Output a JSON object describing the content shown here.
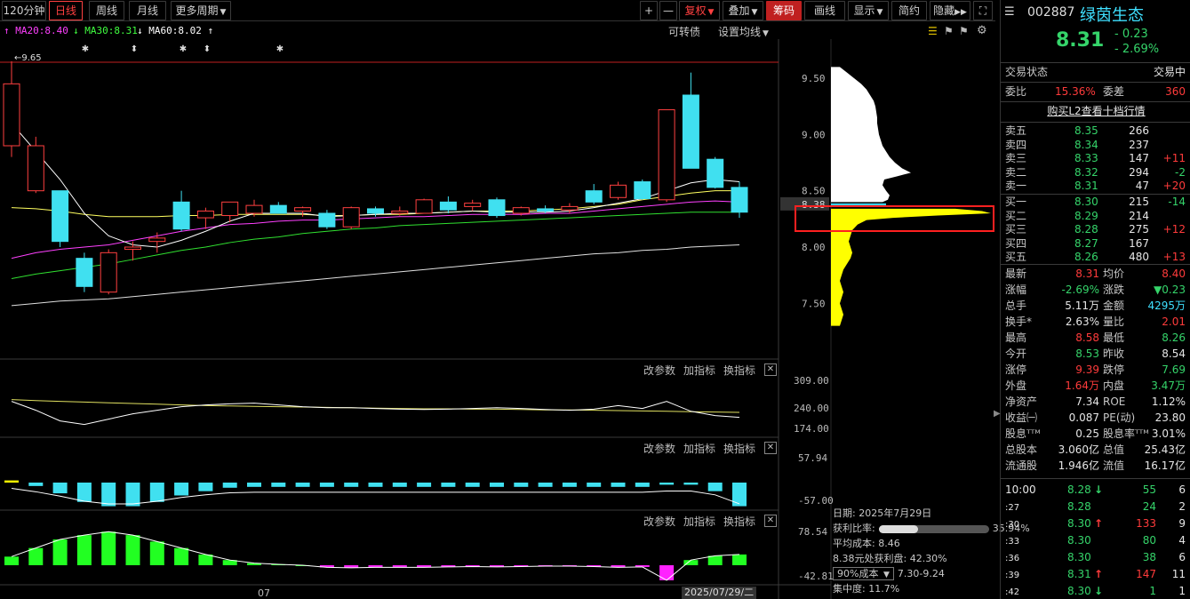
{
  "toolbar": {
    "period_120": "120分钟",
    "daily": "日线",
    "weekly": "周线",
    "monthly": "月线",
    "more_periods": "更多周期",
    "plus": "+",
    "minus": "—",
    "restore_right": "复权",
    "overlay": "叠加",
    "chips": "筹码",
    "draw": "画线",
    "display": "显示",
    "simple": "简约",
    "hide": "隐藏"
  },
  "ma_legend": {
    "ma20": "MA20:8.40",
    "ma30": "MA30:8.31",
    "ma60": "MA60:8.02",
    "convertible": "可转债",
    "set_ma": "设置均线",
    "colors": {
      "ma20": "#ff40ff",
      "ma30": "#40ff40",
      "ma60": "#ffffff"
    }
  },
  "main_chart": {
    "high_marker": "9.65",
    "price_ticks": [
      "9.50",
      "9.00",
      "8.50",
      "8.00",
      "7.50"
    ],
    "current_price_tag": "8.38"
  },
  "sub_panels": [
    {
      "actions": [
        "改参数",
        "加指标",
        "换指标"
      ],
      "ticks": [
        "309.00",
        "240.00",
        "174.00"
      ]
    },
    {
      "actions": [
        "改参数",
        "加指标",
        "换指标"
      ],
      "ticks": [
        "57.94",
        "-57.00"
      ]
    },
    {
      "actions": [
        "改参数",
        "加指标",
        "换指标"
      ],
      "ticks": [
        "78.54",
        "-42.81"
      ]
    }
  ],
  "chip_info": {
    "date": "日期: 2025年7月29日",
    "profit_label": "获利比率:",
    "profit_value": "35.94%",
    "profit_fraction": 0.3594,
    "avg_cost": "平均成本: 8.46",
    "profit_at": "8.38元处获利盘: 42.30%",
    "cost_select": "90%成本",
    "cost_range": "7.30-9.24",
    "concentration": "集中度: 11.7%"
  },
  "axis": {
    "month_label": "07",
    "cursor_date": "2025/07/29/二"
  },
  "quote": {
    "code": "002887",
    "name": "绿茵生态",
    "price": "8.31",
    "change": "- 0.23",
    "change_pct": "- 2.69%",
    "trade_status_label": "交易状态",
    "trade_status": "交易中",
    "weibi_label": "委比",
    "weibi": "15.36%",
    "weicha_label": "委差",
    "weicha": "360",
    "l2_link": "购买L2查看十档行情"
  },
  "order_book": {
    "asks": [
      {
        "label": "卖五",
        "price": "8.35",
        "vol": "266",
        "chg": ""
      },
      {
        "label": "卖四",
        "price": "8.34",
        "vol": "237",
        "chg": ""
      },
      {
        "label": "卖三",
        "price": "8.33",
        "vol": "147",
        "chg": "+11"
      },
      {
        "label": "卖二",
        "price": "8.32",
        "vol": "294",
        "chg": "-2"
      },
      {
        "label": "卖一",
        "price": "8.31",
        "vol": "47",
        "chg": "+20"
      }
    ],
    "bids": [
      {
        "label": "买一",
        "price": "8.30",
        "vol": "215",
        "chg": "-14"
      },
      {
        "label": "买二",
        "price": "8.29",
        "vol": "214",
        "chg": ""
      },
      {
        "label": "买三",
        "price": "8.28",
        "vol": "275",
        "chg": "+12"
      },
      {
        "label": "买四",
        "price": "8.27",
        "vol": "167",
        "chg": ""
      },
      {
        "label": "买五",
        "price": "8.26",
        "vol": "480",
        "chg": "+13"
      }
    ]
  },
  "stats": [
    {
      "l1": "最新",
      "v1": "8.31",
      "c1": "red",
      "l2": "均价",
      "v2": "8.40",
      "c2": "red"
    },
    {
      "l1": "涨幅",
      "v1": "-2.69%",
      "c1": "green",
      "l2": "涨跌",
      "v2": "▼0.23",
      "c2": "green"
    },
    {
      "l1": "总手",
      "v1": "5.11万",
      "c1": "white",
      "l2": "金额",
      "v2": "4295万",
      "c2": "cyan"
    },
    {
      "l1": "换手*",
      "v1": "2.63%",
      "c1": "white",
      "l2": "量比",
      "v2": "2.01",
      "c2": "red"
    },
    {
      "l1": "最高",
      "v1": "8.58",
      "c1": "red",
      "l2": "最低",
      "v2": "8.26",
      "c2": "green"
    },
    {
      "l1": "今开",
      "v1": "8.53",
      "c1": "green",
      "l2": "昨收",
      "v2": "8.54",
      "c2": "white"
    },
    {
      "l1": "涨停",
      "v1": "9.39",
      "c1": "red",
      "l2": "跌停",
      "v2": "7.69",
      "c2": "green"
    },
    {
      "l1": "外盘",
      "v1": "1.64万",
      "c1": "red",
      "l2": "内盘",
      "v2": "3.47万",
      "c2": "green"
    },
    {
      "l1": "净资产",
      "v1": "7.34",
      "c1": "white",
      "l2": "ROE",
      "v2": "1.12%",
      "c2": "white"
    },
    {
      "l1": "收益㈠",
      "v1": "0.087",
      "c1": "white",
      "l2": "PE(动)",
      "v2": "23.80",
      "c2": "white"
    },
    {
      "l1": "股息ᵀᵀᴹ",
      "v1": "0.25",
      "c1": "white",
      "l2": "股息率ᵀᵀᴹ",
      "v2": "3.01%",
      "c2": "white"
    },
    {
      "l1": "总股本",
      "v1": "3.060亿",
      "c1": "white",
      "l2": "总值",
      "v2": "25.43亿",
      "c2": "white"
    },
    {
      "l1": "流通股",
      "v1": "1.946亿",
      "c1": "white",
      "l2": "流值",
      "v2": "16.17亿",
      "c2": "white"
    }
  ],
  "ticks": [
    {
      "time": "10:00",
      "price": "8.28",
      "arrow": "↓",
      "arrow_color": "green",
      "vol": "55",
      "vol_color": "green",
      "n": "6"
    },
    {
      "time": ":27",
      "price": "8.28",
      "arrow": "",
      "arrow_color": "",
      "vol": "24",
      "vol_color": "green",
      "n": "2"
    },
    {
      "time": ":30",
      "price": "8.30",
      "arrow": "↑",
      "arrow_color": "red",
      "vol": "133",
      "vol_color": "red",
      "n": "9"
    },
    {
      "time": ":33",
      "price": "8.30",
      "arrow": "",
      "arrow_color": "",
      "vol": "80",
      "vol_color": "green",
      "n": "4"
    },
    {
      "time": ":36",
      "price": "8.30",
      "arrow": "",
      "arrow_color": "",
      "vol": "38",
      "vol_color": "green",
      "n": "6"
    },
    {
      "time": ":39",
      "price": "8.31",
      "arrow": "↑",
      "arrow_color": "red",
      "vol": "147",
      "vol_color": "red",
      "n": "11"
    },
    {
      "time": ":42",
      "price": "8.30",
      "arrow": "↓",
      "arrow_color": "green",
      "vol": "1",
      "vol_color": "green",
      "n": "1"
    }
  ],
  "chart_data": {
    "type": "candlestick",
    "candles": [
      {
        "o": 8.9,
        "h": 9.65,
        "l": 8.8,
        "c": 9.45
      },
      {
        "o": 8.5,
        "h": 8.98,
        "l": 8.48,
        "c": 8.9
      },
      {
        "o": 8.5,
        "h": 8.5,
        "l": 8.0,
        "c": 8.05
      },
      {
        "o": 7.9,
        "h": 7.95,
        "l": 7.6,
        "c": 7.65
      },
      {
        "o": 7.6,
        "h": 7.98,
        "l": 7.58,
        "c": 7.95
      },
      {
        "o": 7.98,
        "h": 8.05,
        "l": 7.88,
        "c": 8.0
      },
      {
        "o": 8.05,
        "h": 8.13,
        "l": 7.95,
        "c": 8.08
      },
      {
        "o": 8.4,
        "h": 8.5,
        "l": 8.14,
        "c": 8.16
      },
      {
        "o": 8.26,
        "h": 8.35,
        "l": 8.16,
        "c": 8.32
      },
      {
        "o": 8.28,
        "h": 8.4,
        "l": 8.22,
        "c": 8.4
      },
      {
        "o": 8.3,
        "h": 8.42,
        "l": 8.27,
        "c": 8.37
      },
      {
        "o": 8.37,
        "h": 8.4,
        "l": 8.3,
        "c": 8.3
      },
      {
        "o": 8.32,
        "h": 8.36,
        "l": 8.27,
        "c": 8.35
      },
      {
        "o": 8.3,
        "h": 8.33,
        "l": 8.16,
        "c": 8.18
      },
      {
        "o": 8.18,
        "h": 8.36,
        "l": 8.16,
        "c": 8.35
      },
      {
        "o": 8.34,
        "h": 8.36,
        "l": 8.27,
        "c": 8.3
      },
      {
        "o": 8.3,
        "h": 8.36,
        "l": 8.28,
        "c": 8.32
      },
      {
        "o": 8.3,
        "h": 8.43,
        "l": 8.3,
        "c": 8.42
      },
      {
        "o": 8.4,
        "h": 8.45,
        "l": 8.3,
        "c": 8.33
      },
      {
        "o": 8.36,
        "h": 8.42,
        "l": 8.32,
        "c": 8.39
      },
      {
        "o": 8.42,
        "h": 8.44,
        "l": 8.26,
        "c": 8.28
      },
      {
        "o": 8.3,
        "h": 8.36,
        "l": 8.28,
        "c": 8.35
      },
      {
        "o": 8.34,
        "h": 8.37,
        "l": 8.3,
        "c": 8.32
      },
      {
        "o": 8.33,
        "h": 8.39,
        "l": 8.3,
        "c": 8.36
      },
      {
        "o": 8.5,
        "h": 8.56,
        "l": 8.38,
        "c": 8.4
      },
      {
        "o": 8.44,
        "h": 8.58,
        "l": 8.42,
        "c": 8.55
      },
      {
        "o": 8.58,
        "h": 8.6,
        "l": 8.42,
        "c": 8.43
      },
      {
        "o": 8.42,
        "h": 9.22,
        "l": 8.4,
        "c": 9.22
      },
      {
        "o": 9.35,
        "h": 9.55,
        "l": 8.7,
        "c": 8.7
      },
      {
        "o": 8.78,
        "h": 8.8,
        "l": 8.52,
        "c": 8.53
      },
      {
        "o": 8.53,
        "h": 8.58,
        "l": 8.26,
        "c": 8.31
      }
    ],
    "ma_short": [
      9.1,
      8.85,
      8.6,
      8.3,
      8.1,
      8.02,
      8.0,
      8.06,
      8.14,
      8.23,
      8.3,
      8.3,
      8.3,
      8.27,
      8.28,
      8.29,
      8.3,
      8.3,
      8.31,
      8.32,
      8.31,
      8.31,
      8.31,
      8.32,
      8.35,
      8.39,
      8.43,
      8.5,
      8.57,
      8.6,
      8.58
    ],
    "ma20": [
      7.9,
      7.95,
      7.98,
      8.0,
      8.02,
      8.06,
      8.1,
      8.14,
      8.17,
      8.2,
      8.21,
      8.23,
      8.24,
      8.24,
      8.25,
      8.26,
      8.27,
      8.27,
      8.28,
      8.29,
      8.29,
      8.29,
      8.3,
      8.3,
      8.32,
      8.34,
      8.36,
      8.38,
      8.4,
      8.41,
      8.4
    ],
    "ma30": [
      7.72,
      7.76,
      7.79,
      7.82,
      7.85,
      7.89,
      7.93,
      7.97,
      8.0,
      8.04,
      8.07,
      8.09,
      8.12,
      8.14,
      8.16,
      8.17,
      8.19,
      8.2,
      8.21,
      8.22,
      8.23,
      8.24,
      8.25,
      8.26,
      8.27,
      8.28,
      8.29,
      8.3,
      8.31,
      8.31,
      8.31
    ],
    "ma_long": [
      8.35,
      8.34,
      8.32,
      8.29,
      8.27,
      8.27,
      8.27,
      8.28,
      8.28,
      8.29,
      8.29,
      8.29,
      8.29,
      8.28,
      8.28,
      8.29,
      8.29,
      8.3,
      8.31,
      8.32,
      8.32,
      8.32,
      8.33,
      8.34,
      8.36,
      8.38,
      8.42,
      8.45,
      8.48,
      8.5,
      8.5
    ],
    "ma60": [
      7.48,
      7.5,
      7.52,
      7.53,
      7.54,
      7.56,
      7.58,
      7.6,
      7.62,
      7.64,
      7.66,
      7.68,
      7.7,
      7.72,
      7.74,
      7.76,
      7.78,
      7.8,
      7.82,
      7.84,
      7.86,
      7.88,
      7.9,
      7.92,
      7.94,
      7.95,
      7.97,
      7.98,
      8.0,
      8.01,
      8.02
    ],
    "yaxis": [
      7.2,
      9.7
    ],
    "ind1_line1": [
      250,
      225,
      195,
      185,
      200,
      215,
      225,
      235,
      240,
      243,
      245,
      240,
      235,
      232,
      232,
      230,
      228,
      227,
      228,
      230,
      232,
      230,
      227,
      225,
      228,
      238,
      230,
      250,
      222,
      210,
      205
    ],
    "ind1_line2": [
      255,
      252,
      250,
      248,
      246,
      244,
      242,
      240,
      238,
      237,
      236,
      235,
      234,
      233,
      232,
      231,
      230,
      229,
      229,
      228,
      228,
      227,
      226,
      226,
      225,
      224,
      223,
      222,
      221,
      220,
      219
    ],
    "ind1_range": [
      174,
      309
    ],
    "ind2_bars": [
      5,
      -8,
      -25,
      -45,
      -55,
      -55,
      -45,
      -30,
      -20,
      -12,
      -10,
      -10,
      -10,
      -10,
      -10,
      -10,
      -10,
      -10,
      -10,
      -10,
      -10,
      -10,
      -10,
      -10,
      -10,
      -10,
      -10,
      -5,
      -5,
      -20,
      -55
    ],
    "ind2_range": [
      -57,
      57.94
    ],
    "ind3_bars": [
      20,
      40,
      60,
      70,
      78,
      70,
      55,
      40,
      25,
      12,
      5,
      2,
      0,
      -5,
      -6,
      -5,
      -5,
      -5,
      -4,
      -3,
      -4,
      -3,
      -2,
      -2,
      -3,
      -5,
      -4,
      -35,
      12,
      22,
      25
    ],
    "ind3_range": [
      -42.81,
      78.54
    ],
    "chip_profile_top": [
      [
        9.6,
        10
      ],
      [
        9.55,
        18
      ],
      [
        9.5,
        26
      ],
      [
        9.45,
        34
      ],
      [
        9.4,
        40
      ],
      [
        9.35,
        44
      ],
      [
        9.3,
        48
      ],
      [
        9.25,
        50
      ],
      [
        9.2,
        51
      ],
      [
        9.15,
        52
      ],
      [
        9.1,
        52
      ],
      [
        9.05,
        53
      ],
      [
        9.0,
        54
      ],
      [
        8.95,
        56
      ],
      [
        8.9,
        58
      ],
      [
        8.85,
        62
      ],
      [
        8.8,
        66
      ],
      [
        8.75,
        72
      ],
      [
        8.7,
        80
      ],
      [
        8.66,
        90
      ],
      [
        8.63,
        75
      ],
      [
        8.6,
        60
      ],
      [
        8.55,
        58
      ],
      [
        8.5,
        62
      ],
      [
        8.46,
        66
      ],
      [
        8.42,
        64
      ],
      [
        8.4,
        58
      ]
    ],
    "chip_profile_bottom": [
      [
        8.34,
        140
      ],
      [
        8.32,
        170
      ],
      [
        8.3,
        180
      ],
      [
        8.28,
        120
      ],
      [
        8.26,
        70
      ],
      [
        8.24,
        40
      ],
      [
        8.2,
        30
      ],
      [
        8.15,
        24
      ],
      [
        8.1,
        22
      ],
      [
        8.05,
        20
      ],
      [
        8.0,
        22
      ],
      [
        7.95,
        24
      ],
      [
        7.9,
        22
      ],
      [
        7.85,
        18
      ],
      [
        7.8,
        14
      ],
      [
        7.75,
        12
      ],
      [
        7.7,
        10
      ],
      [
        7.65,
        12
      ],
      [
        7.6,
        14
      ],
      [
        7.55,
        12
      ],
      [
        7.5,
        10
      ],
      [
        7.45,
        12
      ],
      [
        7.4,
        14
      ],
      [
        7.35,
        12
      ],
      [
        7.3,
        10
      ]
    ]
  }
}
